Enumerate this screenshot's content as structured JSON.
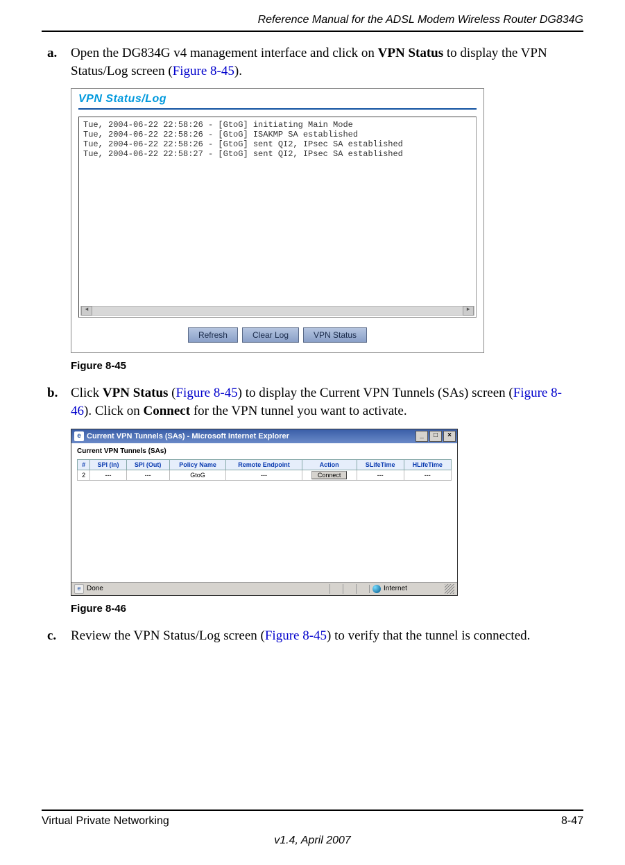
{
  "header": {
    "manual_title": "Reference Manual for the ADSL Modem Wireless Router DG834G"
  },
  "steps": {
    "a": {
      "marker": "a.",
      "t1": "Open the DG834G v4 management interface and click on ",
      "bold1": "VPN Status",
      "t2": " to display the VPN Status/Log screen (",
      "link1": "Figure 8-45",
      "t3": ")."
    },
    "b": {
      "marker": "b.",
      "t1": "Click ",
      "bold1": "VPN Status",
      "t2": " (",
      "link1": "Figure 8-45",
      "t3": ") to display the Current VPN Tunnels (SAs) screen (",
      "link2": "Figure 8-46",
      "t4": "). Click on ",
      "bold2": "Connect",
      "t5": " for the VPN tunnel you want to activate."
    },
    "c": {
      "marker": "c.",
      "t1": "Review the VPN Status/Log screen (",
      "link1": "Figure 8-45",
      "t2": ") to verify that the tunnel is connected."
    }
  },
  "fig45": {
    "caption": "Figure 8-45",
    "panel_title": "VPN Status/Log",
    "log_lines": [
      "Tue, 2004-06-22 22:58:26 - [GtoG] initiating Main Mode",
      "Tue, 2004-06-22 22:58:26 - [GtoG] ISAKMP SA established",
      "Tue, 2004-06-22 22:58:26 - [GtoG] sent QI2, IPsec SA established",
      "Tue, 2004-06-22 22:58:27 - [GtoG] sent QI2, IPsec SA established"
    ],
    "buttons": {
      "refresh": "Refresh",
      "clear": "Clear Log",
      "status": "VPN Status"
    }
  },
  "fig46": {
    "caption": "Figure 8-46",
    "window_title": "Current VPN Tunnels (SAs) - Microsoft Internet Explorer",
    "body_title": "Current VPN Tunnels (SAs)",
    "headers": [
      "#",
      "SPI (In)",
      "SPI (Out)",
      "Policy Name",
      "Remote Endpoint",
      "Action",
      "SLifeTime",
      "HLifeTime"
    ],
    "row": {
      "num": "2",
      "spi_in": "---",
      "spi_out": "---",
      "policy": "GtoG",
      "remote": "---",
      "action": "Connect",
      "slife": "---",
      "hlife": "---"
    },
    "status_done": "Done",
    "status_internet": "Internet"
  },
  "footer": {
    "section": "Virtual Private Networking",
    "page": "8-47",
    "version": "v1.4, April 2007"
  }
}
